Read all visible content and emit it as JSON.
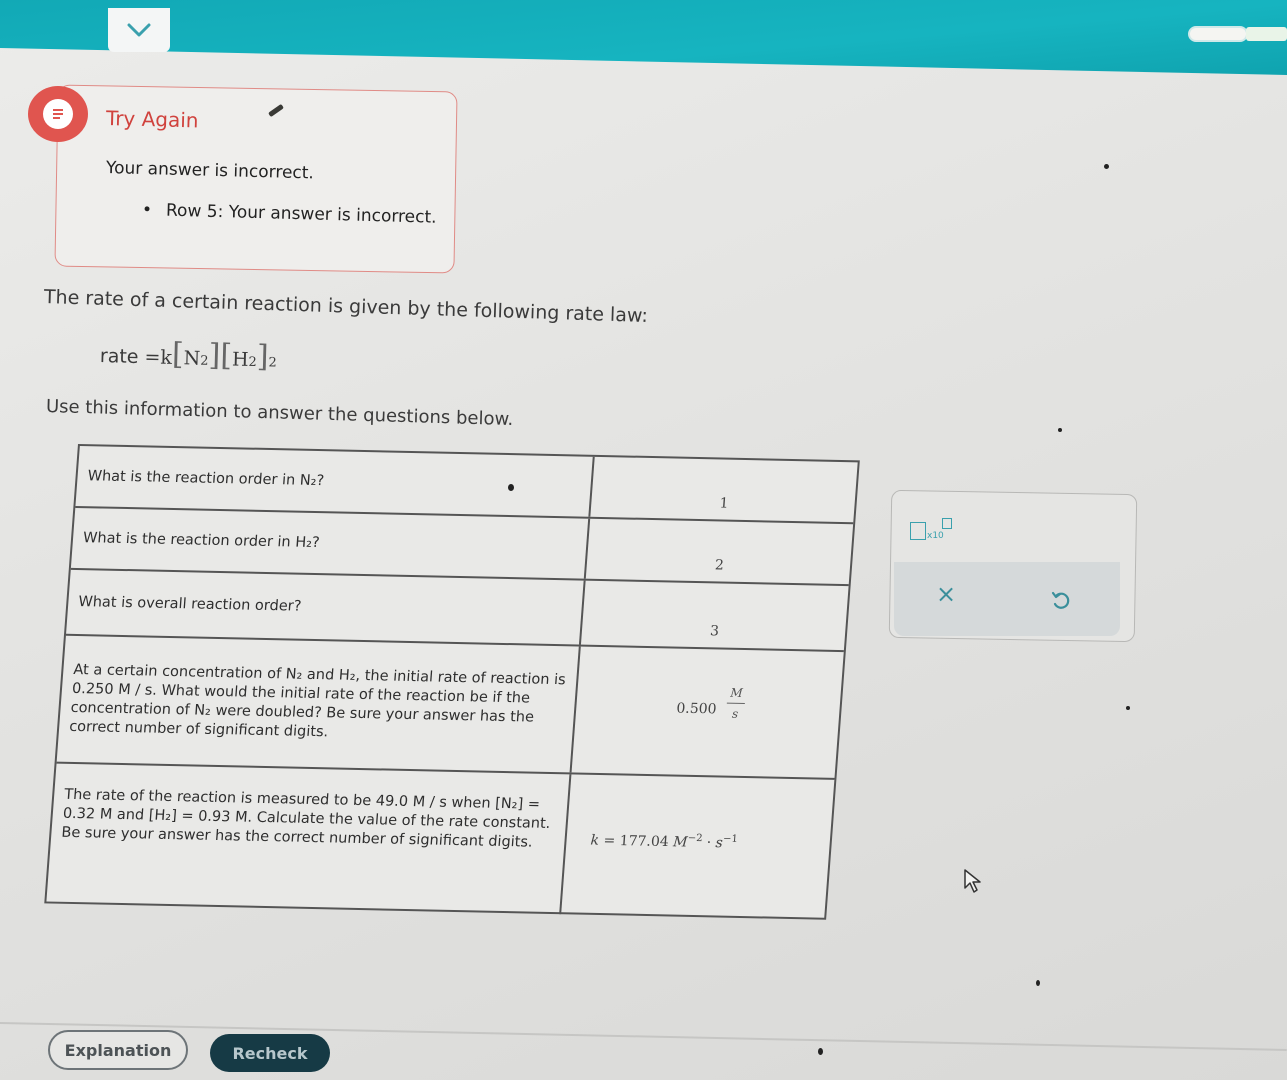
{
  "colors": {
    "accent_teal": "#12a9b6",
    "alert_red": "#d0423d",
    "recheck_bg": "#163a45"
  },
  "header": {
    "dropdown_icon": "chevron-down-icon"
  },
  "alert": {
    "title": "Try Again",
    "message": "Your answer is incorrect.",
    "items": [
      "Row 5: Your answer is incorrect."
    ]
  },
  "problem": {
    "intro": "The rate of a certain reaction is given by the following rate law:",
    "rate_law": {
      "lhs": "rate",
      "equals": "=",
      "k": "k",
      "species1": "N",
      "sub1": "2",
      "species2": "H",
      "sub2": "2",
      "exponent": "2"
    },
    "instruction": "Use this information to answer the questions below."
  },
  "table": {
    "rows": [
      {
        "question": "What is the reaction order in N₂?",
        "answer": "1"
      },
      {
        "question": "What is the reaction order in H₂?",
        "answer": "2"
      },
      {
        "question": "What is overall reaction order?",
        "answer": "3"
      },
      {
        "question": "At a certain concentration of N₂ and H₂, the initial rate of reaction is 0.250 M / s. What would the initial rate of the reaction be if the concentration of N₂ were doubled? Be sure your answer has the correct number of significant digits.",
        "answer": "0.500",
        "unit_numerator": "M",
        "unit_denominator": "s"
      },
      {
        "question": "The rate of the reaction is measured to be 49.0 M / s when [N₂] = 0.32 M and [H₂] = 0.93 M. Calculate the value of the rate constant. Be sure your answer has the correct number of significant digits.",
        "answer_prefix": "k =",
        "answer": "177.04",
        "unit_M": "M",
        "exp_M": "−2",
        "unit_dot": "·",
        "unit_s": "s",
        "exp_s": "−1"
      }
    ]
  },
  "tools": {
    "x10_label": "x10",
    "clear_icon": "close-icon",
    "undo_icon": "undo-icon"
  },
  "footer": {
    "explanation_label": "Explanation",
    "recheck_label": "Recheck"
  }
}
